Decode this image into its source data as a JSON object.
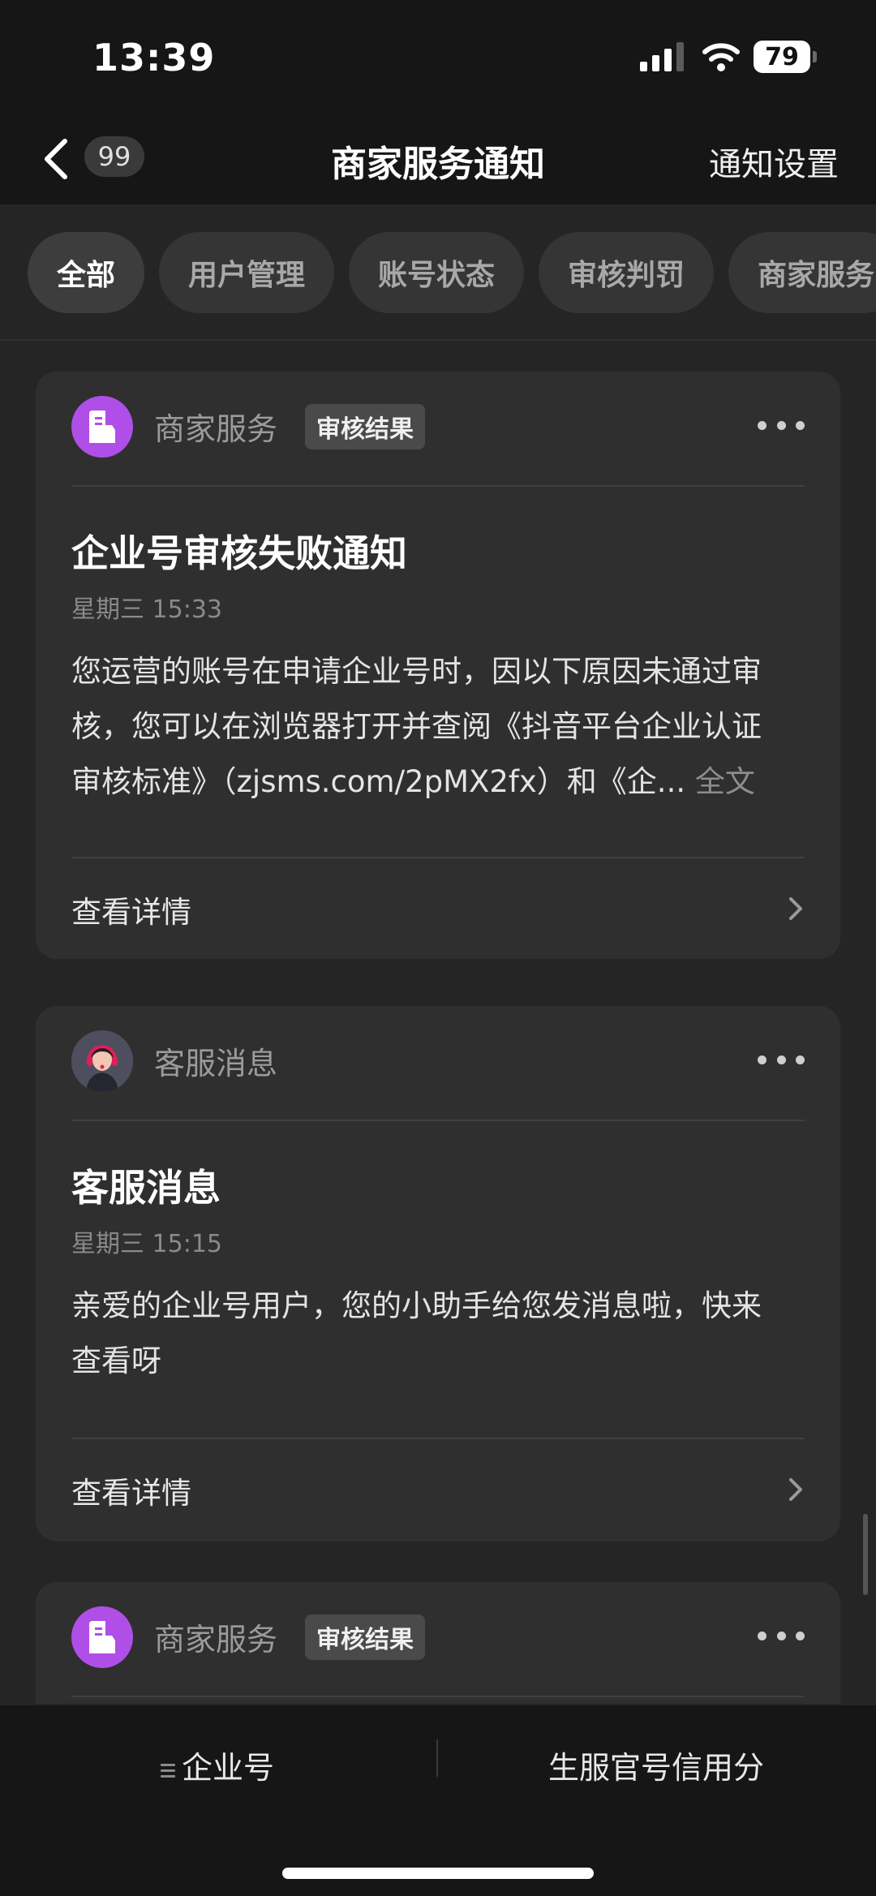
{
  "status_bar": {
    "time": "13:39",
    "battery": "79"
  },
  "nav": {
    "back_badge": "99",
    "title": "商家服务通知",
    "settings_label": "通知设置"
  },
  "tabs": [
    {
      "label": "全部",
      "active": true
    },
    {
      "label": "用户管理"
    },
    {
      "label": "账号状态"
    },
    {
      "label": "审核判罚"
    },
    {
      "label": "商家服务"
    }
  ],
  "cards": [
    {
      "sender": "商家服务",
      "tag": "审核结果",
      "title": "企业号审核失败通知",
      "time": "星期三 15:33",
      "body_lines": [
        "您运营的账号在申请企业号时，因以下原因未通过审",
        "核，您可以在浏览器打开并查阅《抖音平台企业认证",
        "审核标准》（zjsms.com/2pMX2fx）和《企..."
      ],
      "full_text": "全文",
      "detail_label": "查看详情"
    },
    {
      "sender": "客服消息",
      "title": "客服消息",
      "time": "星期三 15:15",
      "body_lines": [
        "亲爱的企业号用户，您的小助手给您发消息啦，快来",
        "查看呀"
      ],
      "detail_label": "查看详情"
    },
    {
      "sender": "商家服务",
      "tag": "审核结果"
    }
  ],
  "bottom_bar": {
    "left_label": "企业号",
    "right_label": "生服官号信用分"
  },
  "colors": {
    "background": "#161616",
    "card": "#2f2f2f",
    "merchant_avatar": "#b04ee8"
  }
}
